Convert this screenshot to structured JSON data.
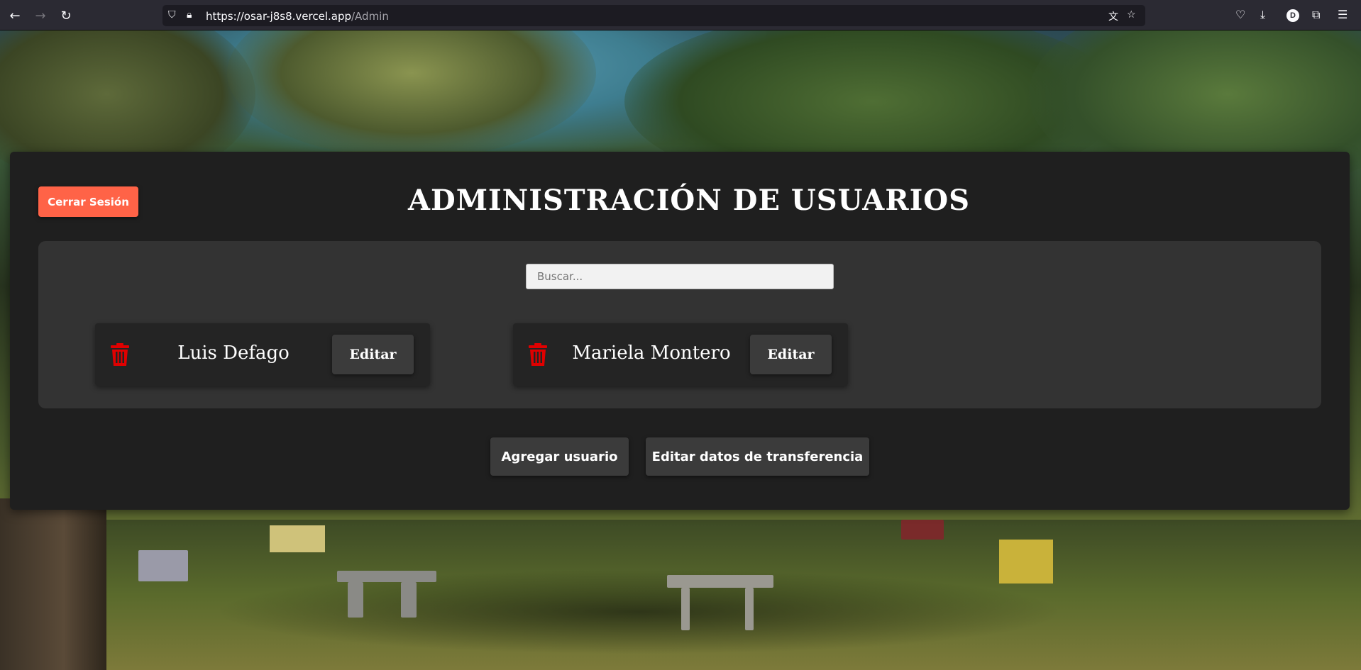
{
  "browser": {
    "url_host": "https://osar-j8s8.vercel.app",
    "url_path": "/Admin",
    "profile_initial": "D",
    "icons": {
      "back": "back-arrow-icon",
      "forward": "forward-arrow-icon",
      "reload": "reload-icon",
      "shield": "shield-icon",
      "lock": "lock-icon",
      "translate": "translate-icon",
      "bookmark": "star-icon",
      "pocket": "pocket-icon",
      "downloads": "download-icon",
      "extensions": "puzzle-icon",
      "menu": "hamburger-menu-icon"
    }
  },
  "header": {
    "logout_label": "Cerrar Sesión",
    "title": "ADMINISTRACIÓN DE USUARIOS"
  },
  "search": {
    "placeholder": "Buscar...",
    "value": ""
  },
  "users": [
    {
      "name": "Luis Defago",
      "edit_label": "Editar",
      "delete_icon": "trash-icon"
    },
    {
      "name": "Mariela Montero",
      "edit_label": "Editar",
      "delete_icon": "trash-icon"
    }
  ],
  "actions": {
    "add_user_label": "Agregar usuario",
    "edit_transfer_label": "Editar datos de transferencia"
  },
  "colors": {
    "logout_button": "#ff6347",
    "panel_background": "#1f1f1f",
    "users_box_background": "#333333",
    "trash_icon": "#e00000"
  }
}
